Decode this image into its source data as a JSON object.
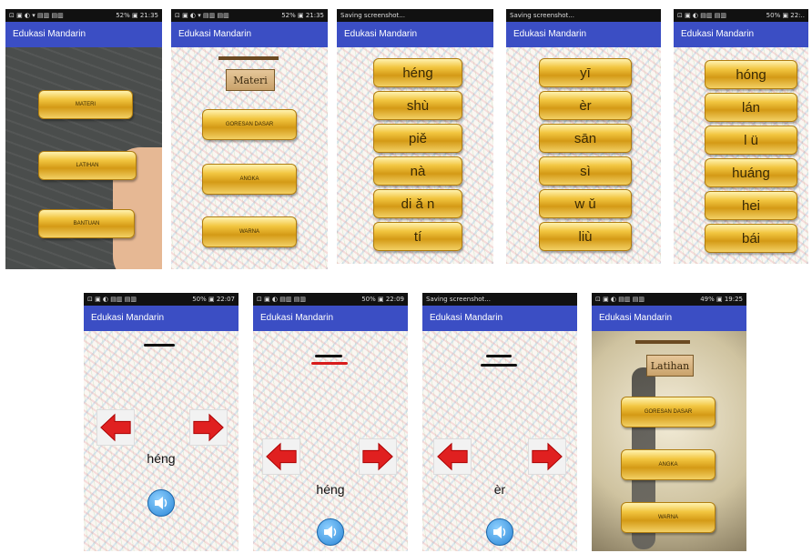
{
  "app_title": "Edukasi Mandarin",
  "screens": {
    "s1": {
      "status_left": "⊡ ▣ ◐ ▾ ▤▥ ▤▥",
      "status_right": "52% ▣ 21:35",
      "title": "Edukasi Mandarin",
      "menu": [
        "MATERI",
        "LATIHAN",
        "BANTUAN"
      ]
    },
    "s2": {
      "status_left": "⊡ ▣ ◐ ▾ ▤▥ ▤▥",
      "status_right": "52% ▣ 21:35",
      "title": "Edukasi Mandarin",
      "sign": "Materi",
      "menu": [
        "GORESAN DASAR",
        "ANGKA",
        "WARNA"
      ]
    },
    "s3": {
      "status_left": "Saving screenshot...",
      "title": "Edukasi Mandarin",
      "items": [
        "héng",
        "shù",
        "piě",
        "nà",
        "di ǎ n",
        "tí"
      ]
    },
    "s4": {
      "status_left": "Saving screenshot...",
      "title": "Edukasi Mandarin",
      "items": [
        "yī",
        "èr",
        "sān",
        "sì",
        "w ǔ",
        "liù"
      ]
    },
    "s5": {
      "status_left": "⊡ ▣ ◐ ▤▥ ▤▥",
      "status_right": "50% ▣ 22:..",
      "title": "Edukasi Mandarin",
      "items": [
        "hóng",
        "lán",
        "l ü",
        "huáng",
        "hei",
        "bái"
      ]
    },
    "s6": {
      "status_left": "⊡ ▣ ◐ ▤▥ ▤▥",
      "status_right": "50% ▣ 22:07",
      "title": "Edukasi Mandarin",
      "word": "héng",
      "stroke_color": "#111111"
    },
    "s7": {
      "status_left": "⊡ ▣ ◐ ▤▥ ▤▥",
      "status_right": "50% ▣ 22:09",
      "title": "Edukasi Mandarin",
      "word": "héng",
      "stroke_color": "#d81b1b"
    },
    "s8": {
      "status_left": "Saving screenshot...",
      "title": "Edukasi Mandarin",
      "word": "èr",
      "stroke_color": "#111111"
    },
    "s9": {
      "status_left": "⊡ ▣ ◐ ▤▥ ▤▥",
      "status_right": "49% ▣ 19:25",
      "title": "Edukasi Mandarin",
      "sign": "Latihan",
      "menu": [
        "GORESAN DASAR",
        "ANGKA",
        "WARNA"
      ]
    }
  },
  "colors": {
    "appbar": "#3b4ec4",
    "gold": "#f2c640",
    "arrow": "#e02020"
  },
  "icons": [
    "left-arrow-icon",
    "right-arrow-icon",
    "speaker-icon"
  ]
}
